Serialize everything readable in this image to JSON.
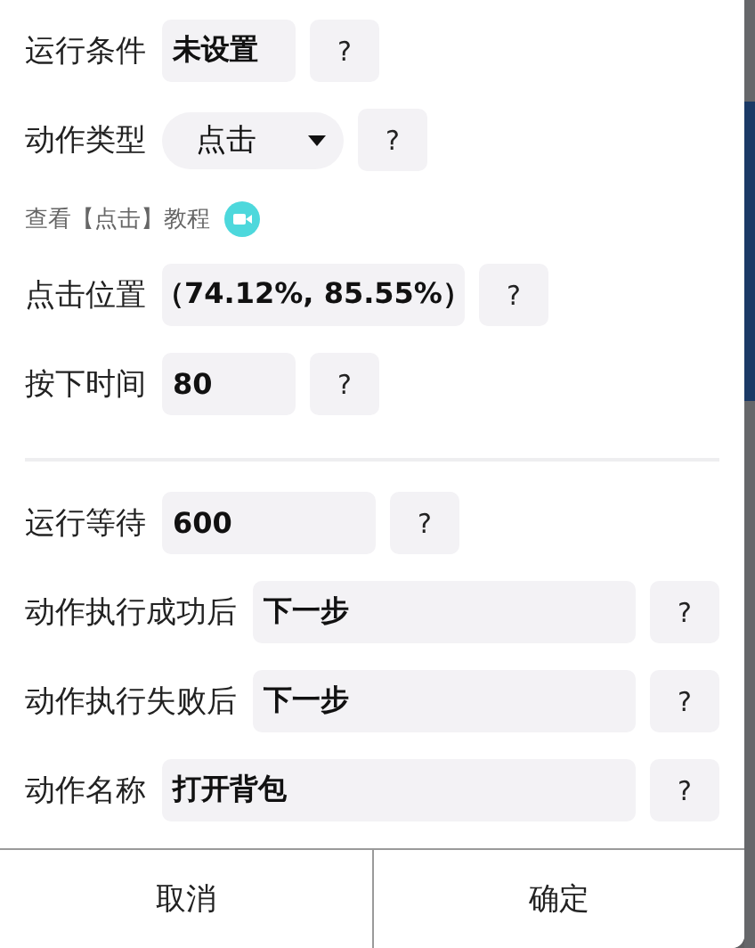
{
  "sections": [
    {
      "items": [
        {
          "kind": "field",
          "label": "运行条件",
          "value": "未设置",
          "help": "?"
        },
        {
          "kind": "select",
          "label": "动作类型",
          "value": "点击",
          "help": "?"
        },
        {
          "kind": "link",
          "text": "查看【点击】教程"
        },
        {
          "kind": "field",
          "label": "点击位置",
          "value": "（74.12%, 85.55%）",
          "help": "?"
        },
        {
          "kind": "field",
          "label": "按下时间",
          "value": "80",
          "help": "?"
        }
      ]
    },
    {
      "items": [
        {
          "kind": "field",
          "label": "运行等待",
          "value": "600",
          "help": "?"
        },
        {
          "kind": "wide",
          "label": "动作执行成功后",
          "value": "下一步",
          "help": "?"
        },
        {
          "kind": "wide",
          "label": "动作执行失败后",
          "value": "下一步",
          "help": "?"
        },
        {
          "kind": "wide",
          "label": "动作名称",
          "value": "打开背包",
          "help": "?"
        }
      ]
    }
  ],
  "buttons": [
    "取消",
    "确定"
  ]
}
